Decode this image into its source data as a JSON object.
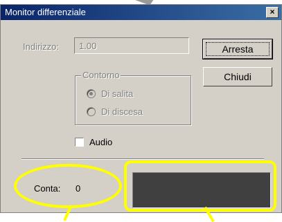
{
  "window": {
    "title": "Monitor differenziale",
    "close_glyph": "×"
  },
  "address": {
    "label": "Indirizzo:",
    "value": "1.00"
  },
  "buttons": {
    "stop": "Arresta",
    "close": "Chiudi"
  },
  "edge_group": {
    "legend": "Contorno",
    "options": [
      {
        "label": "Di salita",
        "checked": true
      },
      {
        "label": "Di discesa",
        "checked": false
      }
    ]
  },
  "audio": {
    "label": "Audio",
    "checked": false
  },
  "counter": {
    "label": "Conta:",
    "value": "0"
  },
  "colors": {
    "highlight": "#ffff00",
    "display": "#404040",
    "titlebar": "#0a246a"
  }
}
